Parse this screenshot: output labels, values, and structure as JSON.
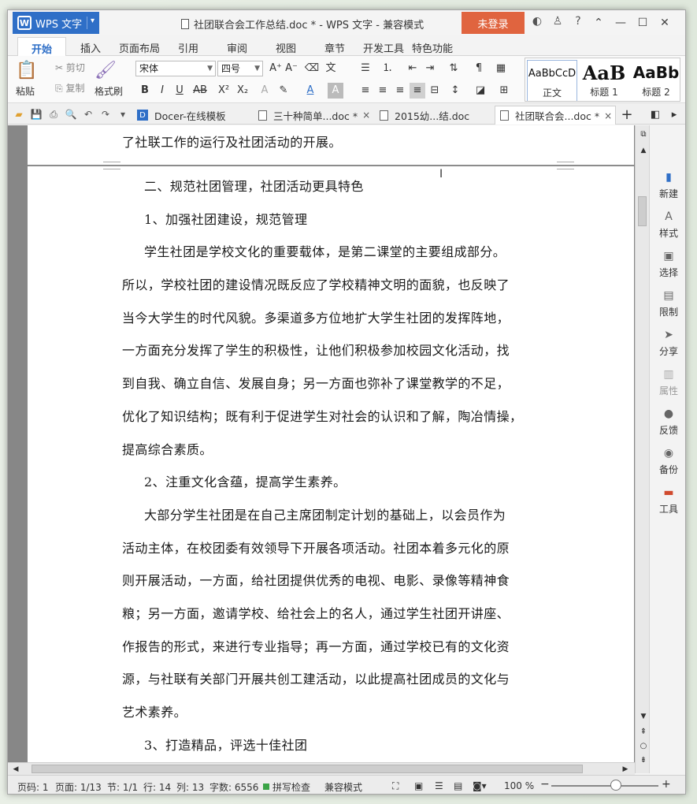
{
  "window": {
    "app_name": "WPS 文字",
    "app_logo": "W",
    "title": "社团联合会工作总结.doc * - WPS 文字 - 兼容模式",
    "login_label": "未登录"
  },
  "ribbon_tabs": [
    "开始",
    "插入",
    "页面布局",
    "引用",
    "审阅",
    "视图",
    "章节",
    "开发工具",
    "特色功能"
  ],
  "ribbon": {
    "paste_label": "粘贴",
    "cut_label": "剪切",
    "copy_label": "复制",
    "format_painter_label": "格式刷",
    "font_name": "宋体",
    "font_size": "四号",
    "styles": [
      {
        "sample": "AaBbCcD",
        "label": "正文"
      },
      {
        "sample": "AaB",
        "label": "标题 1"
      },
      {
        "sample": "AaBb",
        "label": "标题 2"
      }
    ]
  },
  "doc_tabs": [
    {
      "label": "Docer-在线模板",
      "closable": false,
      "active": false
    },
    {
      "label": "三十种简单...doc *",
      "closable": true,
      "active": false
    },
    {
      "label": "2015幼...结.doc",
      "closable": false,
      "active": false
    },
    {
      "label": "社团联合会...doc *",
      "closable": true,
      "active": true
    }
  ],
  "document": {
    "prev_page_tail": "了社联工作的运行及社团活动的开展。",
    "lines": [
      {
        "text": "二、规范社团管理，社团活动更具特色",
        "indent": true
      },
      {
        "text": "1、加强社团建设，规范管理",
        "indent": true
      },
      {
        "text": "学生社团是学校文化的重要载体，是第二课堂的主要组成部分。",
        "indent": true
      },
      {
        "text": "所以，学校社团的建设情况既反应了学校精神文明的面貌，也反映了",
        "indent": false
      },
      {
        "text": "当今大学生的时代风貌。多渠道多方位地扩大学生社团的发挥阵地，",
        "indent": false
      },
      {
        "text": "一方面充分发挥了学生的积极性，让他们积极参加校园文化活动，找",
        "indent": false
      },
      {
        "text": "到自我、确立自信、发展自身；另一方面也弥补了课堂教学的不足，",
        "indent": false
      },
      {
        "text": "优化了知识结构；既有利于促进学生对社会的认识和了解，陶冶情操，",
        "indent": false
      },
      {
        "text": "提高综合素质。",
        "indent": false
      },
      {
        "text": "2、注重文化含蕴，提高学生素养。",
        "indent": true
      },
      {
        "text": "大部分学生社团是在自己主席团制定计划的基础上，以会员作为",
        "indent": true
      },
      {
        "text": "活动主体，在校团委有效领导下开展各项活动。社团本着多元化的原",
        "indent": false
      },
      {
        "text": "则开展活动，一方面，给社团提供优秀的电视、电影、录像等精神食",
        "indent": false
      },
      {
        "text": "粮；另一方面，邀请学校、给社会上的名人，通过学生社团开讲座、",
        "indent": false
      },
      {
        "text": "作报告的形式，来进行专业指导；再一方面，通过学校已有的文化资",
        "indent": false
      },
      {
        "text": "源，与社联有关部门开展共创工建活动，以此提高社团成员的文化与",
        "indent": false
      },
      {
        "text": "艺术素养。",
        "indent": false
      },
      {
        "text": "3、打造精品，评选十佳社团",
        "indent": true
      }
    ]
  },
  "task_pane": [
    "新建",
    "样式",
    "选择",
    "限制",
    "分享",
    "属性",
    "反馈",
    "备份",
    "工具"
  ],
  "status_bar": {
    "page_code": "页码: 1",
    "page": "页面: 1/13",
    "section": "节: 1/1",
    "row": "行: 14",
    "col": "列: 13",
    "word_count": "字数: 6556",
    "spell_check": "拼写检查",
    "compat_mode": "兼容模式",
    "zoom": "100 %",
    "zoom_level": 1.0
  },
  "colors": {
    "accent": "#2f6fc7",
    "login": "#e0643f"
  }
}
